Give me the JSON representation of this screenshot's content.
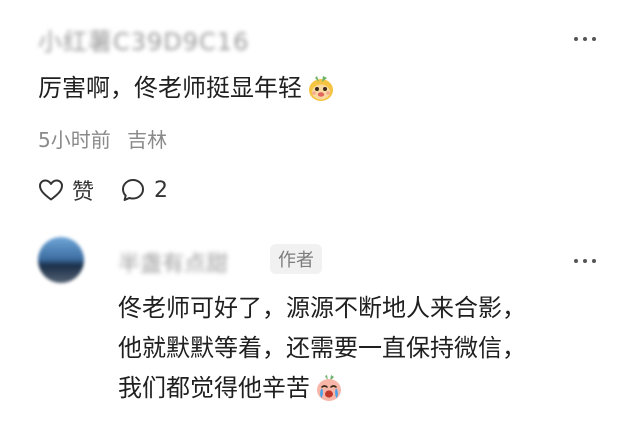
{
  "comment": {
    "username": "小红薯C39D9C16",
    "text": "厉害啊，佟老师挺显年轻",
    "emoji": "face-emoji",
    "time": "5小时前",
    "location": "吉林",
    "like_label": "赞",
    "comment_count": "2"
  },
  "reply": {
    "username": "半盏有点甜",
    "badge": "作者",
    "lines": [
      "佟老师可好了，源源不断地人来合影，",
      "他就默默等着，还需要一直保持微信，",
      "我们都觉得他辛苦"
    ],
    "emoji": "crying-face-emoji"
  },
  "icons": {
    "more": "more-dots-icon",
    "like": "heart-outline-icon",
    "comment": "comment-bubble-icon"
  },
  "colors": {
    "text_primary": "#1f1f1f",
    "text_meta": "#8a8a8a",
    "badge_bg": "#f1f1f1"
  }
}
